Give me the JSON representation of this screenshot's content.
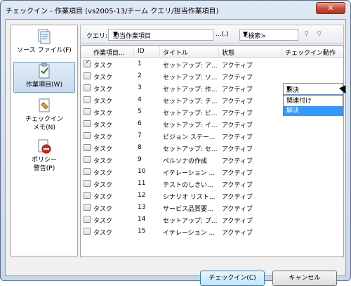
{
  "window": {
    "title": "チェックイン - 作業項目 (vs2005-13/チーム クエリ/担当作業項目)",
    "close": "✕"
  },
  "sidebar": {
    "items": [
      {
        "label_line1": "ソース ファイル(F)",
        "label_line2": "",
        "icon": "source-files-icon"
      },
      {
        "label_line1": "作業項目(W)",
        "label_line2": "",
        "icon": "work-items-icon"
      },
      {
        "label_line1": "チェックイン",
        "label_line2": "メモ(N)",
        "icon": "checkin-notes-icon"
      },
      {
        "label_line1": "ポリシー",
        "label_line2": "警告(P)",
        "icon": "policy-warnings-icon"
      }
    ]
  },
  "toolbar": {
    "query_label": "クエリ:",
    "query_value": "担当作業項目",
    "query_dots": "...(.)",
    "search_value": "<検索>"
  },
  "grid": {
    "columns": [
      "作業項目...",
      "ID",
      "タイトル",
      "状態",
      "チェックイン動作"
    ],
    "rows": [
      {
        "type": "タスク",
        "id": "1",
        "title": "セットアップ: ア...",
        "state": "アクティブ",
        "checked": true
      },
      {
        "type": "タスク",
        "id": "2",
        "title": "セットアップ: ソ...",
        "state": "アクティブ",
        "checked": false
      },
      {
        "type": "タスク",
        "id": "3",
        "title": "セットアップ: 作...",
        "state": "アクティブ",
        "checked": false
      },
      {
        "type": "タスク",
        "id": "4",
        "title": "セットアップ: チ...",
        "state": "アクティブ",
        "checked": false
      },
      {
        "type": "タスク",
        "id": "5",
        "title": "セットアップ: ビ...",
        "state": "アクティブ",
        "checked": false
      },
      {
        "type": "タスク",
        "id": "6",
        "title": "セットアップ: イ...",
        "state": "アクティブ",
        "checked": false
      },
      {
        "type": "タスク",
        "id": "7",
        "title": "ビジョン ステー...",
        "state": "アクティブ",
        "checked": false
      },
      {
        "type": "タスク",
        "id": "8",
        "title": "セットアップ: セ...",
        "state": "アクティブ",
        "checked": false
      },
      {
        "type": "タスク",
        "id": "9",
        "title": "ペルソナの作成",
        "state": "アクティブ",
        "checked": false
      },
      {
        "type": "タスク",
        "id": "10",
        "title": "イテレーション ...",
        "state": "アクティブ",
        "checked": false
      },
      {
        "type": "タスク",
        "id": "11",
        "title": "テストのしきい...",
        "state": "アクティブ",
        "checked": false
      },
      {
        "type": "タスク",
        "id": "12",
        "title": "シナリオ リスト...",
        "state": "アクティブ",
        "checked": false
      },
      {
        "type": "タスク",
        "id": "13",
        "title": "サービス品質要...",
        "state": "アクティブ",
        "checked": false
      },
      {
        "type": "タスク",
        "id": "14",
        "title": "セットアップ: プ...",
        "state": "アクティブ",
        "checked": false
      },
      {
        "type": "タスク",
        "id": "15",
        "title": "イテレーション ...",
        "state": "アクティブ",
        "checked": false
      }
    ],
    "dropdown": {
      "value": "解決",
      "options": [
        "関連付け",
        "解決"
      ],
      "highlighted": "解決"
    }
  },
  "buttons": {
    "checkin": "チェックイン(C)",
    "cancel": "キャンセル"
  }
}
